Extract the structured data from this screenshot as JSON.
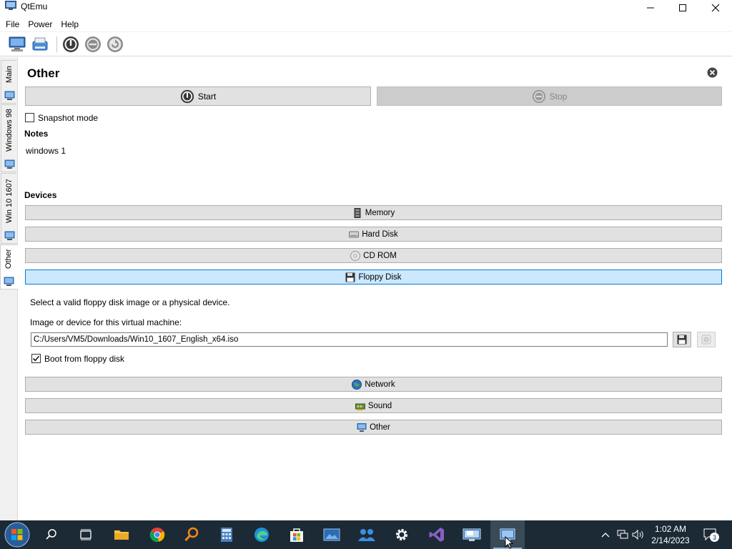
{
  "window": {
    "title": "QtEmu"
  },
  "menu": [
    {
      "label": "File"
    },
    {
      "label": "Power"
    },
    {
      "label": "Help"
    }
  ],
  "toolbar": {
    "icons": [
      "new-machine-icon",
      "machine-settings-icon",
      "power-on-icon",
      "power-off-icon",
      "reset-icon"
    ]
  },
  "tabs": [
    {
      "label": "Main",
      "icon": "monitor-icon"
    },
    {
      "label": "Windows 98",
      "icon": "monitor-icon"
    },
    {
      "label": "Win 10 1607",
      "icon": "monitor-icon"
    },
    {
      "label": "Other",
      "icon": "monitor-icon",
      "active": true
    }
  ],
  "vm": {
    "name": "Other",
    "start_label": "Start",
    "stop_label": "Stop",
    "snapshot_label": "Snapshot mode",
    "snapshot_checked": false,
    "notes_heading": "Notes",
    "notes_text": "windows 1",
    "devices_heading": "Devices"
  },
  "devices": {
    "memory": "Memory",
    "hard_disk": "Hard Disk",
    "cd_rom": "CD ROM",
    "floppy": "Floppy Disk",
    "network": "Network",
    "sound": "Sound",
    "other": "Other"
  },
  "floppy_panel": {
    "hint": "Select a valid floppy disk image or a physical device.",
    "field_label": "Image or device for this virtual machine:",
    "path_value": "C:/Users/VM5/Downloads/Win10_1607_English_x64.iso",
    "boot_label": "Boot from floppy disk",
    "boot_checked": true
  },
  "taskbar": {
    "items": [
      "start-button",
      "search-icon",
      "task-view-icon",
      "file-explorer-icon",
      "chrome-icon",
      "search-tool-icon",
      "calculator-icon",
      "edge-icon",
      "store-icon",
      "photos-icon",
      "people-icon",
      "settings-icon",
      "visual-studio-icon",
      "remote-desktop-icon",
      "qtemu-icon"
    ],
    "clock_time": "1:02 AM",
    "clock_date": "2/14/2023",
    "notification_count": "3"
  },
  "colors": {
    "selected_device_bg": "#cce8ff",
    "selected_device_border": "#0078d7",
    "taskbar_bg": "#1c2a35"
  }
}
